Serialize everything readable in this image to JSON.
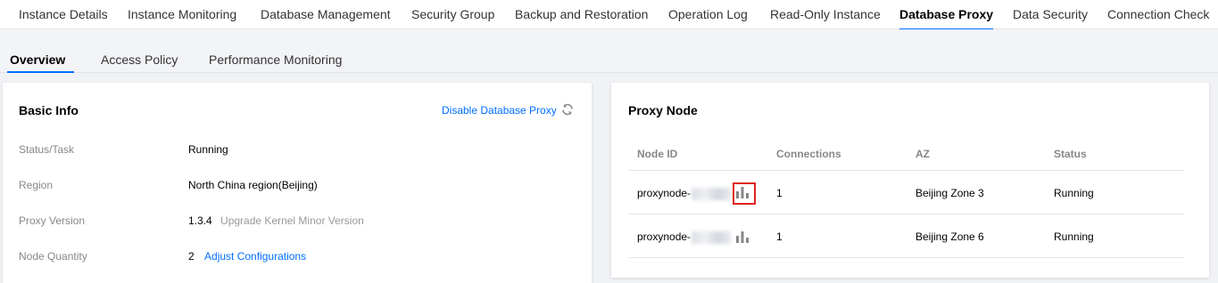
{
  "top_tabs": [
    {
      "label": "Instance Details"
    },
    {
      "label": "Instance Monitoring"
    },
    {
      "label": "Database Management"
    },
    {
      "label": "Security Group"
    },
    {
      "label": "Backup and Restoration"
    },
    {
      "label": "Operation Log"
    },
    {
      "label": "Read-Only Instance"
    },
    {
      "label": "Database Proxy",
      "active": true
    },
    {
      "label": "Data Security"
    },
    {
      "label": "Connection Check"
    }
  ],
  "sub_tabs": [
    {
      "label": "Overview",
      "active": true
    },
    {
      "label": "Access Policy"
    },
    {
      "label": "Performance Monitoring"
    }
  ],
  "basic_info": {
    "title": "Basic Info",
    "disable_link": "Disable Database Proxy",
    "rows": [
      {
        "label": "Status/Task",
        "value": "Running"
      },
      {
        "label": "Region",
        "value": "North China region(Beijing)"
      },
      {
        "label": "Proxy Version",
        "value": "1.3.4",
        "extra": "Upgrade Kernel Minor Version"
      },
      {
        "label": "Node Quantity",
        "value": "2",
        "extra": "Adjust Configurations"
      }
    ]
  },
  "proxy_node": {
    "title": "Proxy Node",
    "columns": [
      "Node ID",
      "Connections",
      "AZ",
      "Status"
    ],
    "rows": [
      {
        "node_id": "proxynode-",
        "connections": "1",
        "az": "Beijing Zone 3",
        "status": "Running"
      },
      {
        "node_id": "proxynode-",
        "connections": "1",
        "az": "Beijing Zone 6",
        "status": "Running"
      }
    ]
  },
  "colors": {
    "accent": "#006eff",
    "running": "#29cc85",
    "highlight": "#e02020"
  },
  "icons": [
    "refresh-icon",
    "bar-chart-icon"
  ]
}
